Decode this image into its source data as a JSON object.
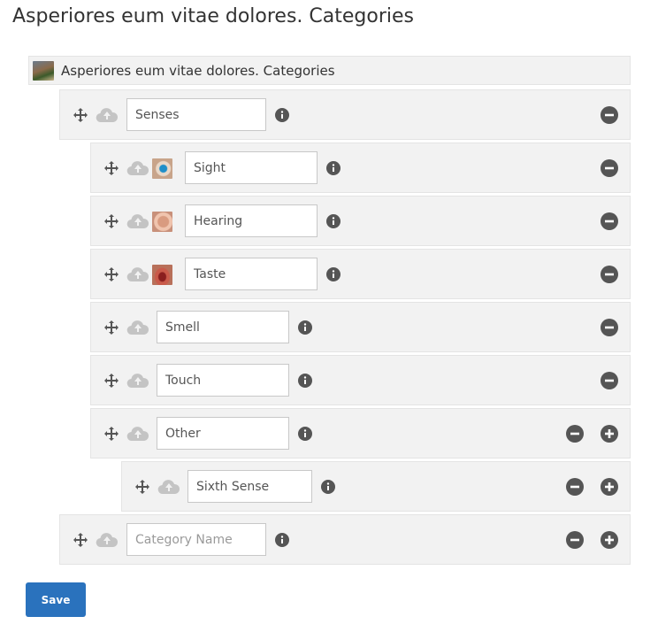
{
  "page": {
    "title": "Asperiores eum vitae dolores. Categories"
  },
  "root": {
    "label": "Asperiores eum vitae dolores. Categories"
  },
  "rows": [
    {
      "value": "Senses",
      "placeholder": "Category Name"
    },
    {
      "value": "Sight",
      "placeholder": "Category Name",
      "thumbnail": "eye"
    },
    {
      "value": "Hearing",
      "placeholder": "Category Name",
      "thumbnail": "ear"
    },
    {
      "value": "Taste",
      "placeholder": "Category Name",
      "thumbnail": "mouth"
    },
    {
      "value": "Smell",
      "placeholder": "Category Name"
    },
    {
      "value": "Touch",
      "placeholder": "Category Name"
    },
    {
      "value": "Other",
      "placeholder": "Category Name"
    },
    {
      "value": "Sixth Sense",
      "placeholder": "Category Name"
    },
    {
      "value": "",
      "placeholder": "Category Name"
    }
  ],
  "actions": {
    "save_label": "Save"
  },
  "colors": {
    "accent": "#2a72bd",
    "row_bg": "#f2f2f2",
    "icon_dark": "#555555",
    "icon_light": "#c4c4c4"
  }
}
